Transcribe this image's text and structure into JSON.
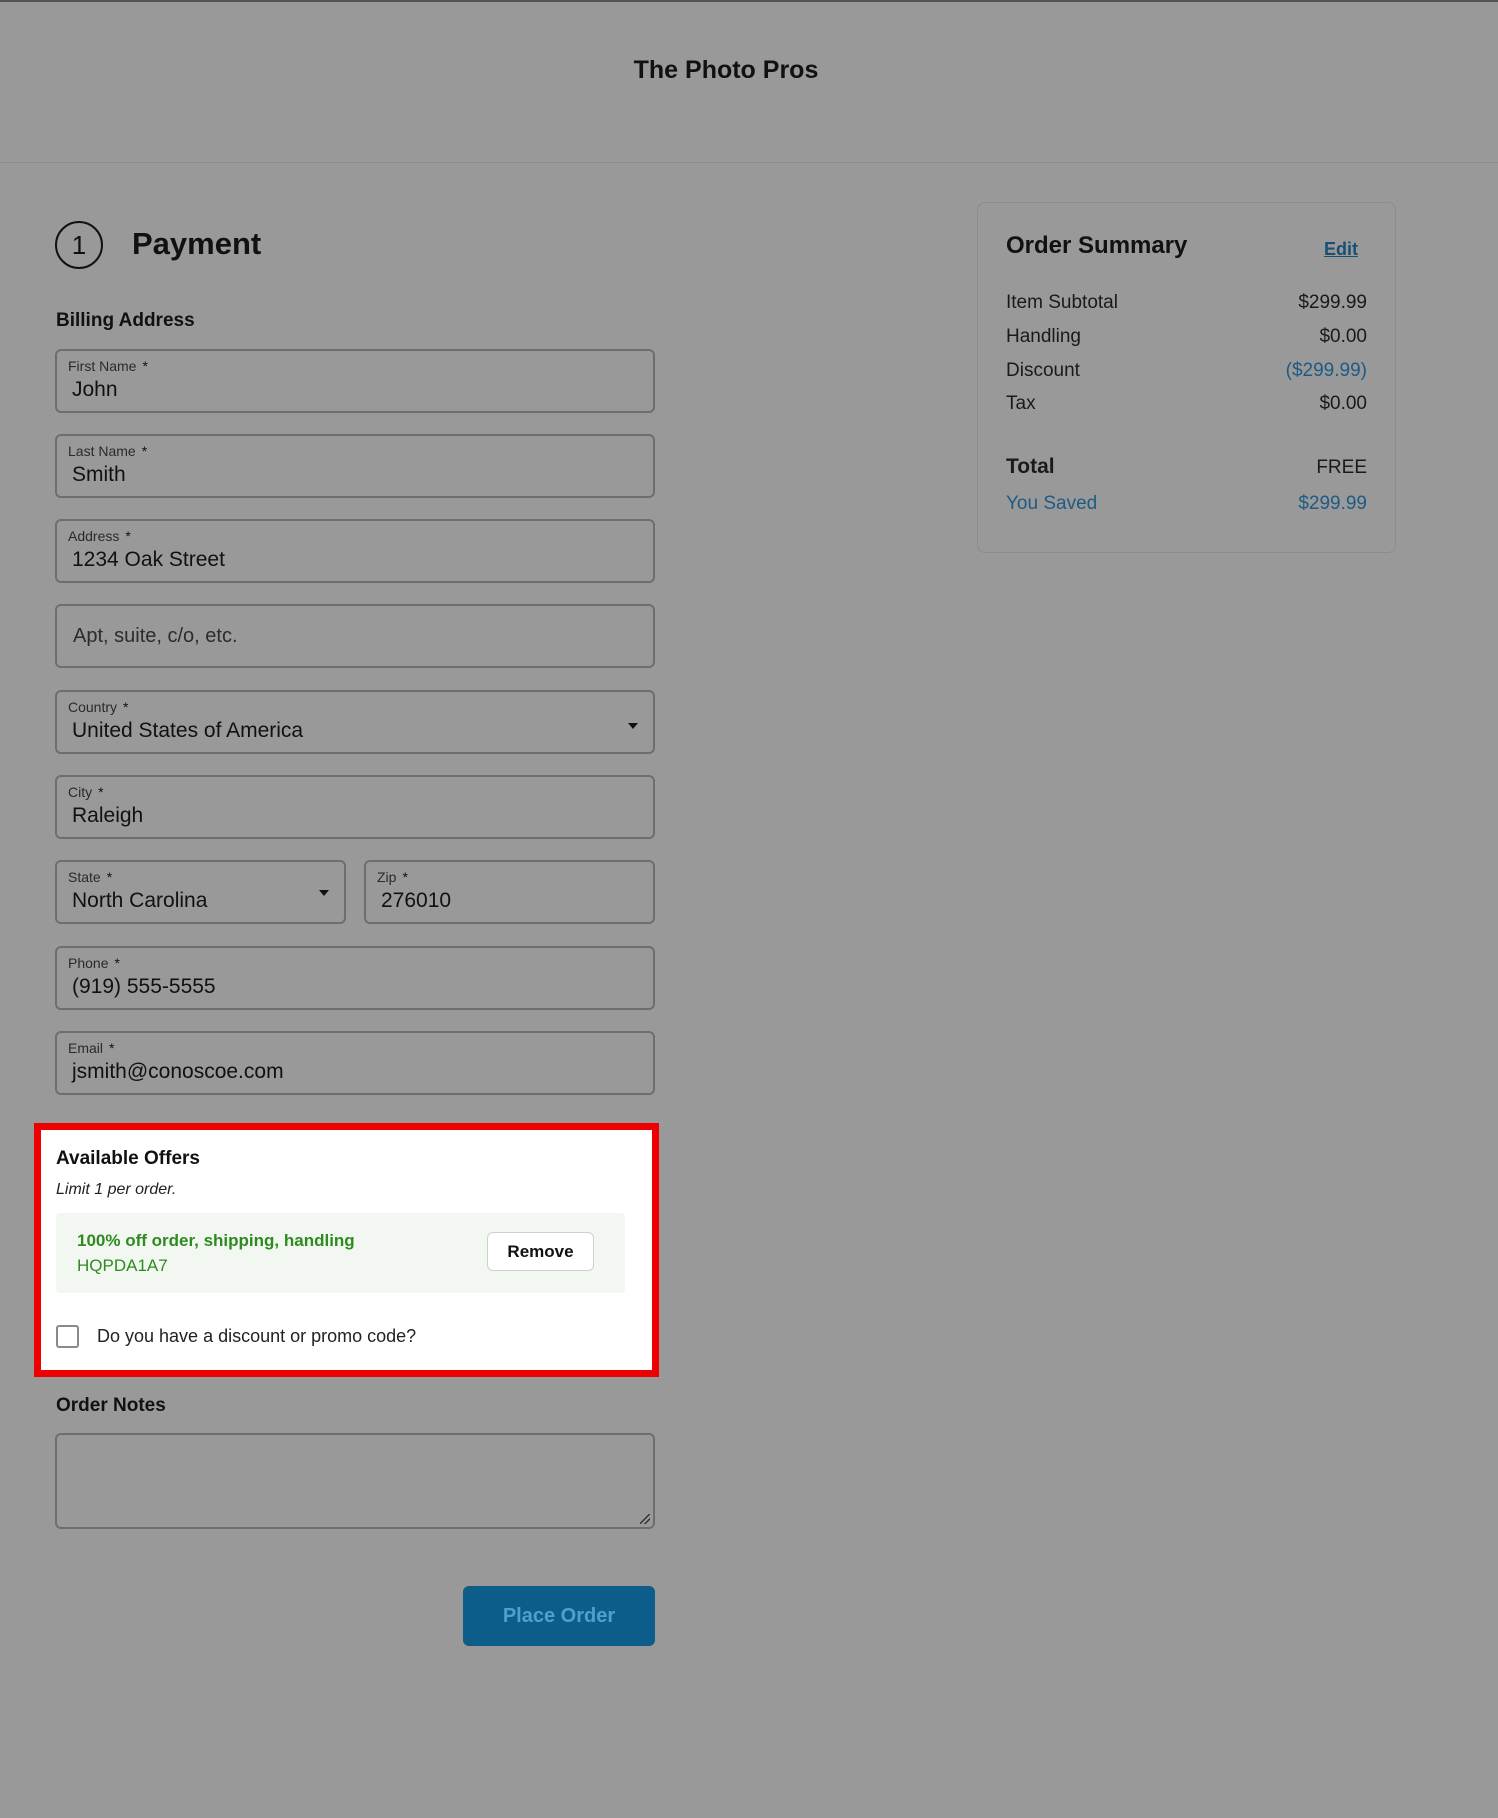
{
  "header": {
    "brand": "The Photo Pros"
  },
  "payment": {
    "step_number": "1",
    "title": "Payment",
    "billing_label": "Billing Address",
    "required_mark": "*",
    "fields": {
      "first_name": {
        "label": "First Name",
        "value": "John"
      },
      "last_name": {
        "label": "Last Name",
        "value": "Smith"
      },
      "address": {
        "label": "Address",
        "value": "1234 Oak Street"
      },
      "address2": {
        "placeholder": "Apt, suite, c/o, etc."
      },
      "country": {
        "label": "Country",
        "value": "United States of America"
      },
      "city": {
        "label": "City",
        "value": "Raleigh"
      },
      "state": {
        "label": "State",
        "value": "North Carolina"
      },
      "zip": {
        "label": "Zip",
        "value": "276010"
      },
      "phone": {
        "label": "Phone",
        "value": "(919) 555-5555"
      },
      "email": {
        "label": "Email",
        "value": "jsmith@conoscoe.com"
      }
    }
  },
  "offers": {
    "title": "Available Offers",
    "limit": "Limit 1 per order.",
    "applied": {
      "description": "100% off order, shipping, handling",
      "code": "HQPDA1A7",
      "remove_label": "Remove"
    },
    "promo_label": "Do you have a discount or promo code?",
    "promo_checked": false
  },
  "notes": {
    "label": "Order Notes"
  },
  "place_order": {
    "label": "Place Order"
  },
  "summary": {
    "title": "Order Summary",
    "edit_label": "Edit",
    "rows": [
      {
        "label": "Item Subtotal",
        "value": "$299.99"
      },
      {
        "label": "Handling",
        "value": "$0.00"
      },
      {
        "label": "Discount",
        "value": "($299.99)"
      },
      {
        "label": "Tax",
        "value": "$0.00"
      }
    ],
    "total": {
      "label": "Total",
      "value": "FREE"
    },
    "saved": {
      "label": "You Saved",
      "value": "$299.99"
    }
  },
  "colors": {
    "background": "#999999",
    "highlight_border": "#ee0000",
    "offer_green": "#2e8b1f",
    "accent_blue": "#1e5b84",
    "button_bg": "#0c5d8a"
  }
}
